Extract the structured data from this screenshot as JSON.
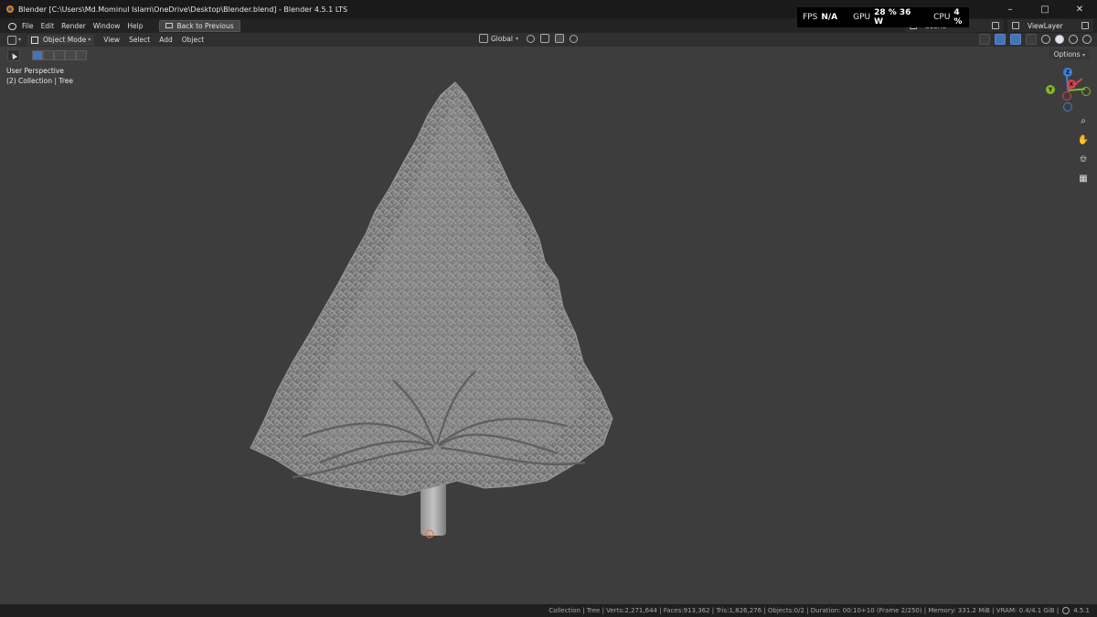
{
  "window": {
    "title": "Blender [C:\\Users\\Md.Mominul Islam\\OneDrive\\Desktop\\Blender.blend] - Blender 4.5.1 LTS",
    "controls": [
      "–",
      "□",
      "✕"
    ]
  },
  "perf": {
    "fps_label": "FPS",
    "fps_value": "N/A",
    "gpu_label": "GPU",
    "gpu_value": "28 %  36 W",
    "cpu_label": "CPU",
    "cpu_value": "4 %"
  },
  "menubar": {
    "items": [
      "File",
      "Edit",
      "Render",
      "Window",
      "Help"
    ],
    "back_button": "Back to Previous",
    "scene": "Scene",
    "view_layer": "ViewLayer"
  },
  "viewport_header": {
    "mode": "Object Mode",
    "menus": [
      "View",
      "Select",
      "Add",
      "Object"
    ],
    "orientation": "Global"
  },
  "viewport": {
    "options": "Options",
    "perspective": "User Perspective",
    "collection": "(2) Collection | Tree"
  },
  "gizmo": {
    "x": "X",
    "y": "Y",
    "z": "Z",
    "colors": {
      "x": "#d8434f",
      "y": "#86b525",
      "z": "#3f80d8"
    }
  },
  "nav_icons": [
    "zoom-icon",
    "hand-pan-icon",
    "camera-icon",
    "grid-icon"
  ],
  "statusbar": {
    "text": "Collection | Tree | Verts:2,271,644 | Faces:913,362 | Tris:1,826,276 | Objects:0/2 | Duration: 00:10+10 (Frame 2/250) | Memory: 331.2 MiB | VRAM: 0.4/4.1 GiB |",
    "version": "4.5.1"
  }
}
